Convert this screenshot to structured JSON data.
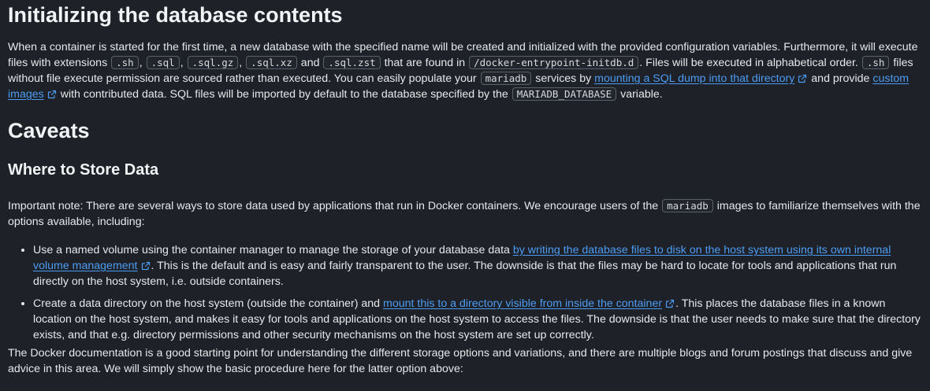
{
  "section1": {
    "heading": "Initializing the database contents",
    "t1": "When a container is started for the first time, a new database with the specified name will be created and initialized with the provided configuration variables. Furthermore, it will execute files with extensions ",
    "c_sh": ".sh",
    "sep1": ", ",
    "c_sql": ".sql",
    "sep2": ", ",
    "c_sqlgz": ".sql.gz",
    "sep3": ", ",
    "c_sqlxz": ".sql.xz",
    "and1": " and ",
    "c_sqlzst": ".sql.zst",
    "t2": " that are found in ",
    "c_dir": "/docker-entrypoint-initdb.d",
    "t3": ". Files will be executed in alphabetical order. ",
    "c_sh2": ".sh",
    "t4": " files without file execute permission are sourced rather than executed. You can easily populate your ",
    "c_mariadb": "mariadb",
    "t5": " services by ",
    "link1": "mounting a SQL dump into that directory",
    "t6": " and provide ",
    "link2": "custom images",
    "t7": " with contributed data. SQL files will be imported by default to the database specified by the ",
    "c_var": "MARIADB_DATABASE",
    "t8": " variable."
  },
  "caveats": {
    "heading": "Caveats"
  },
  "store": {
    "heading": "Where to Store Data",
    "n1": "Important note: There are several ways to store data used by applications that run in Docker containers. We encourage users of the ",
    "c_mariadb": "mariadb",
    "n2": " images to familiarize themselves with the options available, including:",
    "b1_t1": "Use a named volume using the container manager to manage the storage of your database data ",
    "b1_link": "by writing the database files to disk on the host system using its own internal volume management",
    "b1_t2": ". This is the default and is easy and fairly transparent to the user. The downside is that the files may be hard to locate for tools and applications that run directly on the host system, i.e. outside containers.",
    "b2_t1": "Create a data directory on the host system (outside the container) and ",
    "b2_link": "mount this to a directory visible from inside the container",
    "b2_t2": ". This places the database files in a known location on the host system, and makes it easy for tools and applications on the host system to access the files. The downside is that the user needs to make sure that the directory exists, and that e.g. directory permissions and other security mechanisms on the host system are set up correctly.",
    "closing": "The Docker documentation is a good starting point for understanding the different storage options and variations, and there are multiple blogs and forum postings that discuss and give advice in this area. We will simply show the basic procedure here for the latter option above:"
  },
  "icons": {
    "external_link": "external-link-icon"
  },
  "colors": {
    "background": "#1e2127",
    "text": "#e6e8eb",
    "link": "#4d9cf3",
    "code_border": "#5b616b"
  }
}
